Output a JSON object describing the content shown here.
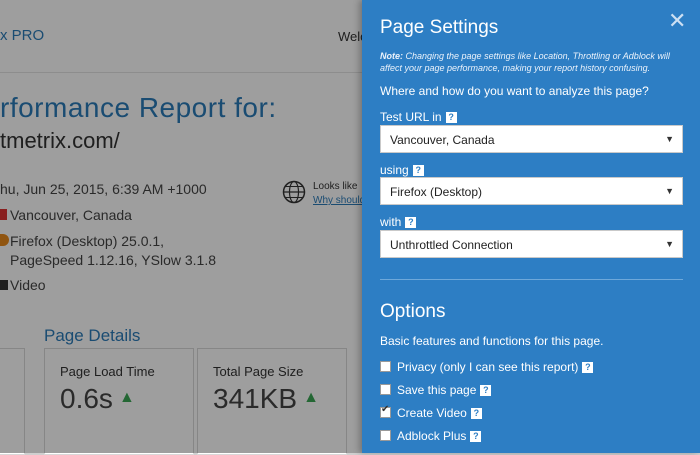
{
  "background": {
    "brand": "x PRO",
    "welcome": "Welc",
    "report_title": "rformance Report for:",
    "report_url": "tmetrix.com/",
    "date": "hu, Jun 25, 2015, 6:39 AM +1000",
    "location": "Vancouver, Canada",
    "browser_line1": "Firefox (Desktop) 25.0.1,",
    "browser_line2": "PageSpeed 1.12.16, YSlow 3.1.8",
    "video": "Video",
    "looks_like": "Looks like",
    "why_should": "Why should",
    "details_title": "Page Details",
    "cards": [
      {
        "label": "Page Load Time",
        "value": "0.6s",
        "arrow": "▲"
      },
      {
        "label": "Total Page Size",
        "value": "341KB",
        "arrow": "▲"
      }
    ]
  },
  "panel": {
    "title": "Page Settings",
    "close": "✕",
    "note_bold": "Note:",
    "note_text": " Changing the page settings like Location, Throttling or Adblock will affect your page performance, making your report history confusing.",
    "question": "Where and how do you want to analyze this page?",
    "help_mark": "?",
    "fields": [
      {
        "label": "Test URL in",
        "value": "Vancouver, Canada"
      },
      {
        "label": "using",
        "value": "Firefox (Desktop)"
      },
      {
        "label": "with",
        "value": "Unthrottled Connection"
      }
    ],
    "options_title": "Options",
    "options_desc": "Basic features and functions for this page.",
    "options": [
      {
        "label": "Privacy (only I can see this report)",
        "checked": false
      },
      {
        "label": "Save this page",
        "checked": false
      },
      {
        "label": "Create Video",
        "checked": true
      },
      {
        "label": "Adblock Plus",
        "checked": false
      }
    ],
    "check_mark": "✔",
    "dropdown_arrow": "▼"
  },
  "colors": {
    "panel_bg": "#2d7ec4",
    "link_blue": "#2b7bb9",
    "up_arrow": "#3aa655"
  }
}
